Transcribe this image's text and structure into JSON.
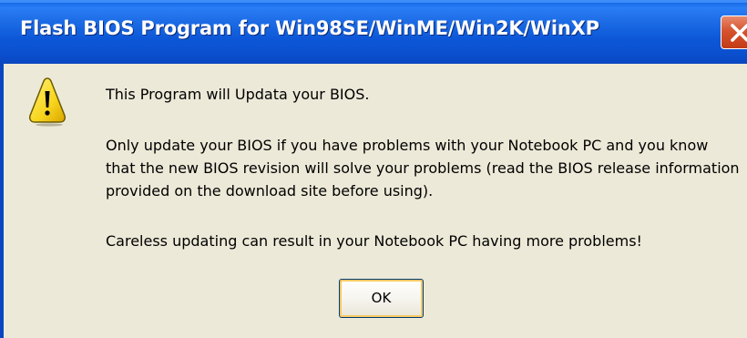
{
  "window": {
    "title": "Flash BIOS Program for Win98SE/WinME/Win2K/WinXP",
    "close_icon": "close-icon"
  },
  "dialog": {
    "icon": "warning-icon",
    "message_1": "This Program will Updata your BIOS.",
    "message_2_lines": [
      "Only update your BIOS if you have problems with your Notebook PC and you know",
      "that the new BIOS revision will solve your problems (read the BIOS release information",
      "provided on the download site before using)."
    ],
    "message_3": "Careless updating can result in your Notebook PC having more problems!",
    "ok_label": "OK"
  },
  "colors": {
    "titlebar": "#0a52d6",
    "close_button": "#d6532f",
    "dialog_background": "#ece9d8",
    "warning_yellow": "#f7d51d"
  }
}
